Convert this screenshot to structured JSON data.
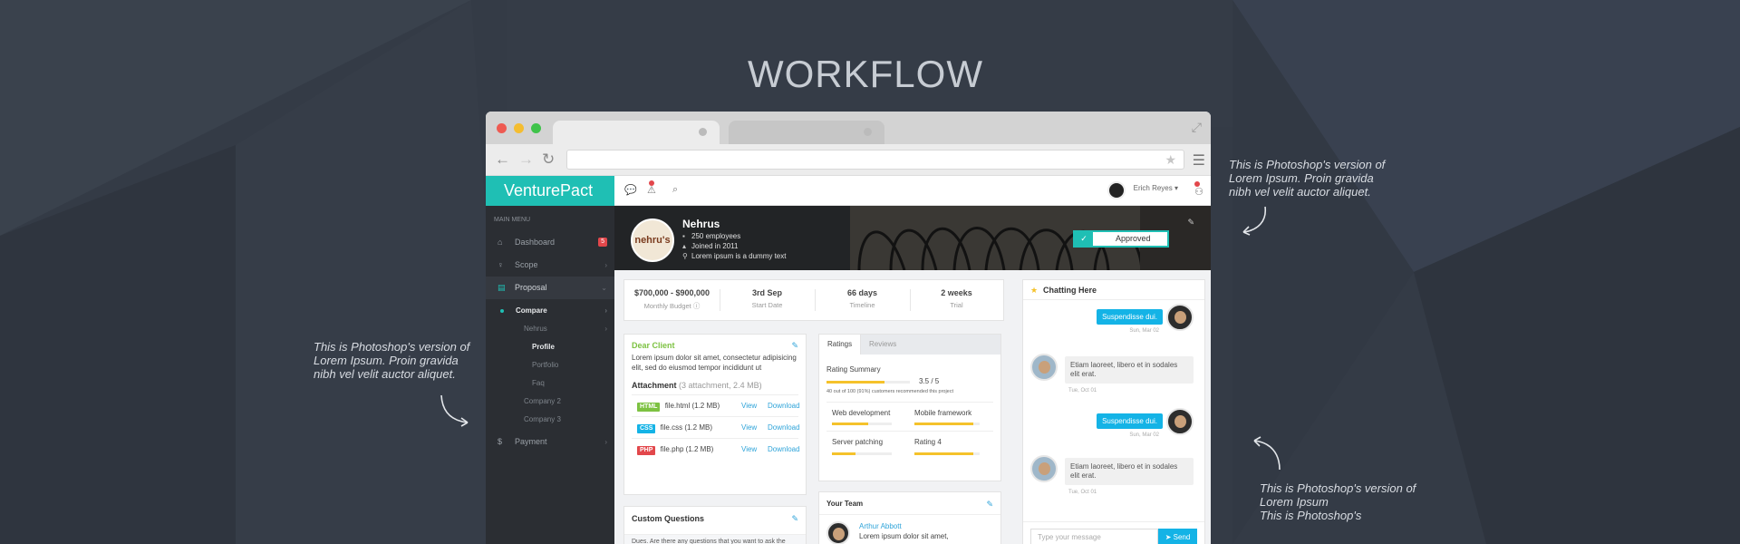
{
  "hero": {
    "title": "WORKFLOW"
  },
  "notes": {
    "right_top": [
      "This is Photoshop's version  of",
      "Lorem Ipsum. Proin gravida",
      "nibh vel velit auctor aliquet."
    ],
    "left": [
      "This is Photoshop's version  of",
      "Lorem Ipsum. Proin gravida",
      "nibh vel velit auctor aliquet."
    ],
    "right_bottom": [
      "This is Photoshop's version  of",
      "Lorem Ipsum",
      "This is Photoshop's"
    ]
  },
  "app": {
    "brand": "VenturePact",
    "user_name": "Erich Reyes ▾"
  },
  "sidebar": {
    "heading": "MAIN MENU",
    "items": [
      {
        "label": "Dashboard",
        "icon": "home-icon",
        "badge": "5"
      },
      {
        "label": "Scope",
        "icon": "lightbulb-icon"
      },
      {
        "label": "Proposal",
        "icon": "document-icon"
      }
    ],
    "proposal_sub": {
      "compare": "Compare",
      "nehrus": "Nehrus",
      "profile": "Profile",
      "portfolio": "Portfolio",
      "faq": "Faq",
      "company2": "Company 2",
      "company3": "Company 3"
    },
    "payment": {
      "label": "Payment",
      "icon": "dollar-icon"
    }
  },
  "banner": {
    "logo_text": "nehru's",
    "name": "Nehrus",
    "employees": "250 employees",
    "joined": "Joined in 2011",
    "location": "Lorem ipsum is a dummy text",
    "status": "Approved"
  },
  "stats": [
    {
      "value": "$700,000 - $900,000",
      "label": "Monthly Budget ⓘ"
    },
    {
      "value": "3rd Sep",
      "label": "Start Date"
    },
    {
      "value": "66 days",
      "label": "Timeline"
    },
    {
      "value": "2 weeks",
      "label": "Trial"
    }
  ],
  "client": {
    "greeting": "Dear Client",
    "body": "Lorem ipsum dolor sit amet, consectetur adipisicing elit, sed do eiusmod tempor incididunt ut",
    "attachment_title": "Attachment",
    "attachment_meta": "(3 attachment, 2.4 MB)",
    "files": [
      {
        "tag": "HTML",
        "name": "file.html (1.2 MB)",
        "color": "#7dc242"
      },
      {
        "tag": "CSS",
        "name": "file.css (1.2 MB)",
        "color": "#14b3e6"
      },
      {
        "tag": "PHP",
        "name": "file.php (1.2 MB)",
        "color": "#e2474b"
      }
    ],
    "view_label": "View",
    "download_label": "Download"
  },
  "custom_questions": {
    "title": "Custom Questions",
    "text": "Dues. Are there any questions that you want to ask the"
  },
  "ratings": {
    "tabs": [
      "Ratings",
      "Reviews"
    ],
    "summary_label": "Rating Summary",
    "score": "3.5 / 5",
    "summary_note": "40 out of 100 (91%) customers recommended this project",
    "summary_fraction": 0.7,
    "items": [
      {
        "label": "Web development",
        "fraction": 0.6
      },
      {
        "label": "Mobile framework",
        "fraction": 0.9
      },
      {
        "label": "Server patching",
        "fraction": 0.4
      },
      {
        "label": "Rating 4",
        "fraction": 0.9
      }
    ]
  },
  "team": {
    "title": "Your Team",
    "member_name": "Arthur Abbott",
    "member_text": "Lorem ipsum dolor sit amet,"
  },
  "chat": {
    "title": "Chatting Here",
    "messages": [
      {
        "dir": "out",
        "text": "Suspendisse dui.",
        "time": "Sun, Mar 02"
      },
      {
        "dir": "in",
        "text": "Etiam laoreet, libero et in sodales elit erat.",
        "time": "Tue, Oct 01"
      },
      {
        "dir": "out",
        "text": "Suspendisse dui.",
        "time": "Sun, Mar 02"
      },
      {
        "dir": "in",
        "text": "Etiam laoreet, libero et in sodales elit erat.",
        "time": "Tue, Oct 01"
      }
    ],
    "input_placeholder": "Type your message",
    "send_label": "Send"
  },
  "colors": {
    "accent": "#1fbfb4",
    "link": "#2fa4d9",
    "rating": "#f5c22b",
    "chat_bubble": "#14b3e6"
  }
}
